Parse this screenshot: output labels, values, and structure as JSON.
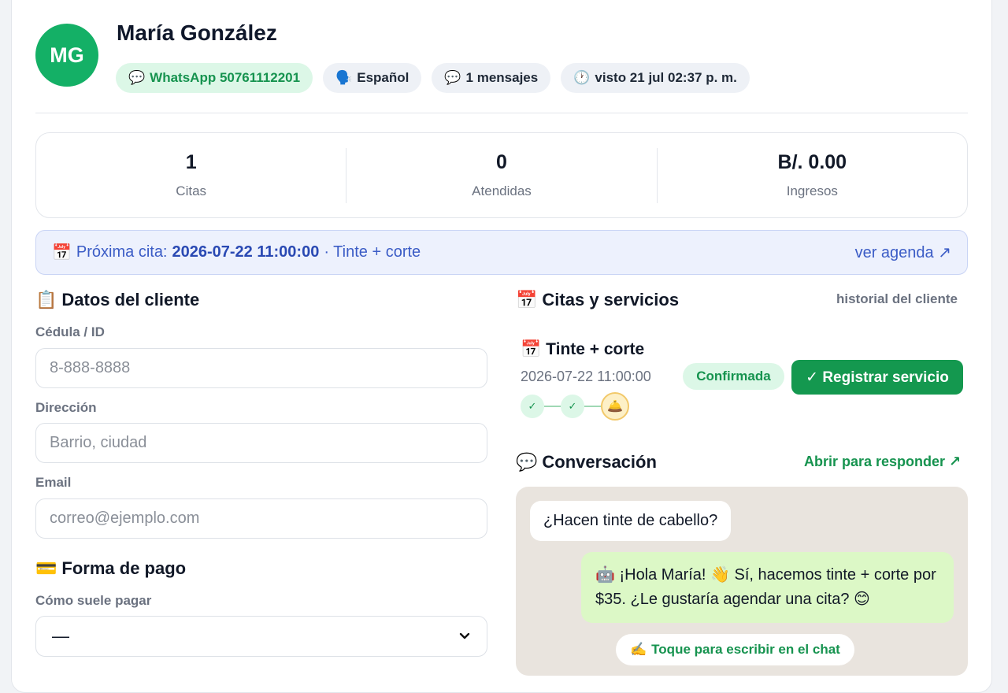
{
  "profile": {
    "initials": "MG",
    "name": "María González",
    "whatsapp": "WhatsApp 50761112201",
    "language": "Español",
    "messages": "1 mensajes",
    "last_seen": "visto 21 jul 02:37 p. m."
  },
  "stats": [
    {
      "value": "1",
      "label": "Citas"
    },
    {
      "value": "0",
      "label": "Atendidas"
    },
    {
      "value": "B/. 0.00",
      "label": "Ingresos"
    }
  ],
  "next_appointment": {
    "label": "Próxima cita:",
    "datetime": "2026-07-22 11:00:00",
    "service": "· Tinte + corte",
    "agenda_link": "ver agenda ↗"
  },
  "client_data": {
    "title": "Datos del cliente",
    "id_label": "Cédula / ID",
    "id_placeholder": "8-888-8888",
    "address_label": "Dirección",
    "address_placeholder": "Barrio, ciudad",
    "email_label": "Email",
    "email_placeholder": "correo@ejemplo.com"
  },
  "payment": {
    "title": "Forma de pago",
    "method_label": "Cómo suele pagar",
    "method_value": "—"
  },
  "appointments": {
    "title": "Citas y servicios",
    "history_link": "historial del cliente",
    "item_title": "Tinte + corte",
    "item_datetime": "2026-07-22 11:00:00",
    "status": "Confirmada",
    "register_button": "✓ Registrar servicio"
  },
  "conversation": {
    "title": "Conversación",
    "open_link": "Abrir para responder ↗",
    "incoming": "¿Hacen tinte de cabello?",
    "outgoing": "🤖 ¡Hola María! 👋 Sí, hacemos tinte + corte por $35. ¿Le gustaría agendar una cita? 😊",
    "tap_prompt": "Toque para escribir en el chat"
  },
  "icons": {
    "whatsapp": "speech-bubble-icon",
    "language": "speaking-head-icon",
    "messages": "speech-bubble-icon",
    "clock": "clock-icon",
    "calendar": "calendar-icon",
    "clipboard": "clipboard-icon",
    "credit_card": "credit-card-icon",
    "bell": "bellhop-bell-icon",
    "writing_hand": "writing-hand-icon"
  },
  "colors": {
    "brand_green": "#14b066",
    "button_green": "#14984f",
    "link_blue": "#3b5cc6",
    "chat_background": "#e9e4de",
    "outgoing_bubble": "#dcf8c6"
  }
}
